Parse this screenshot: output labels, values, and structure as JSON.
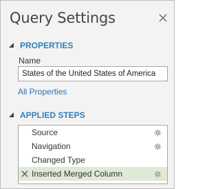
{
  "pane": {
    "title": "Query Settings",
    "close_icon": "close-icon"
  },
  "properties": {
    "header": "PROPERTIES",
    "name_label": "Name",
    "name_value": "States of the United States of America",
    "all_properties_link": "All Properties"
  },
  "applied_steps": {
    "header": "APPLIED STEPS",
    "steps": [
      {
        "label": "Source",
        "has_gear": true,
        "selected": false
      },
      {
        "label": "Navigation",
        "has_gear": true,
        "selected": false
      },
      {
        "label": "Changed Type",
        "has_gear": false,
        "selected": false
      },
      {
        "label": "Inserted Merged Column",
        "has_gear": true,
        "selected": true
      }
    ]
  },
  "colors": {
    "accent": "#2f7fbd",
    "link": "#2b6fb6",
    "selected_row": "#dfe9d5",
    "pane_background": "#f3f3f3"
  }
}
